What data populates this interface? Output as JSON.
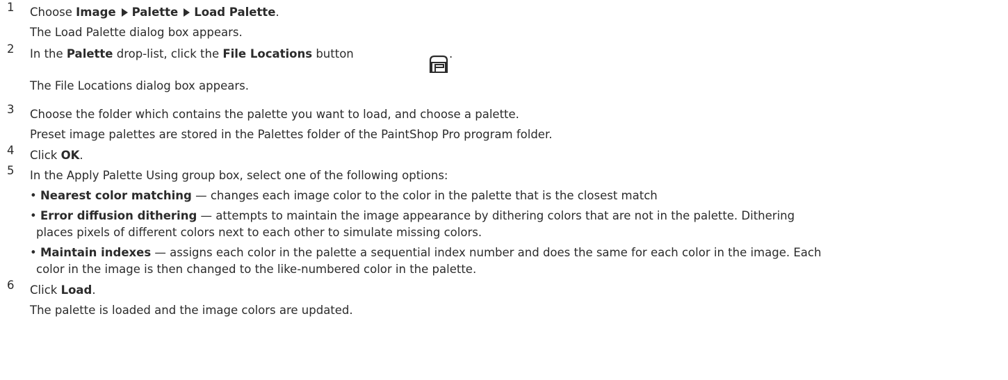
{
  "steps": {
    "s1": {
      "num": "1",
      "prefix": "Choose ",
      "menu1": "Image",
      "menu2": "Palette",
      "menu3": "Load Palette",
      "suffix": ".",
      "note": "The Load Palette dialog box appears."
    },
    "s2": {
      "num": "2",
      "prefix": "In the ",
      "bold1": "Palette",
      "mid": " drop-list, click the ",
      "bold2": "File Locations",
      "suffix": " button",
      "period": ".",
      "icon": "file-locations-icon",
      "note": "The File Locations dialog box appears."
    },
    "s3": {
      "num": "3",
      "text": "Choose the folder which contains the palette you want to load, and choose a palette.",
      "note": "Preset image palettes are stored in the Palettes folder of the PaintShop Pro program folder."
    },
    "s4": {
      "num": "4",
      "prefix": "Click ",
      "bold": "OK",
      "suffix": "."
    },
    "s5": {
      "num": "5",
      "text": "In the Apply Palette Using group box, select one of the following options:",
      "options": [
        {
          "name": "Nearest color matching",
          "desc": " — changes each image color to the color in the palette that is the closest match",
          "desc2": ""
        },
        {
          "name": "Error diffusion dithering",
          "desc": " — attempts to maintain the image appearance by dithering colors that are not in the palette. Dithering",
          "desc2": "places pixels of different colors next to each other to simulate missing colors."
        },
        {
          "name": "Maintain indexes",
          "desc": " — assigns each color in the palette a sequential index number and does the same for each color in the image. Each",
          "desc2": "color in the image is then changed to the like-numbered color in the palette."
        }
      ]
    },
    "s6": {
      "num": "6",
      "prefix": "Click ",
      "bold": "Load",
      "suffix": ".",
      "note": "The palette is loaded and the image colors are updated."
    }
  }
}
